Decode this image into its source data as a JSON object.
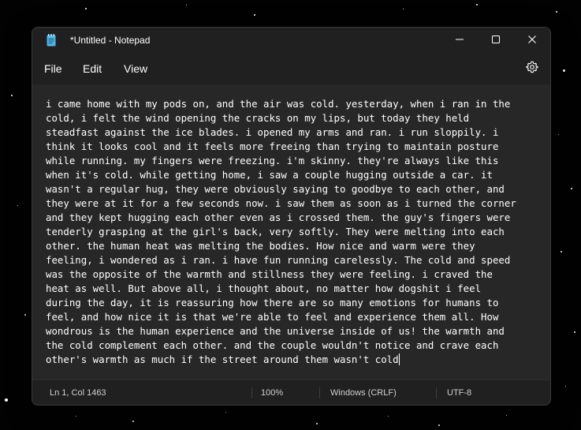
{
  "window": {
    "title": "*Untitled - Notepad",
    "app_icon": "notepad-icon"
  },
  "title_buttons": {
    "minimize_icon": "minimize-icon",
    "maximize_icon": "maximize-icon",
    "close_icon": "close-icon"
  },
  "menubar": {
    "items": [
      {
        "label": "File"
      },
      {
        "label": "Edit"
      },
      {
        "label": "View"
      }
    ],
    "settings_icon": "gear-icon"
  },
  "editor": {
    "lines": [
      "i came home with my pods on, and the air was cold. yesterday, when i ran in the",
      "cold, i felt the wind opening the cracks on my lips, but today they held",
      "steadfast against the ice blades. i opened my arms and ran. i run sloppily. i",
      "think it looks cool and it feels more freeing than trying to maintain posture",
      "while running. my fingers were freezing. i'm skinny. they're always like this",
      "when it's cold. while getting home, i saw a couple hugging outside a car. it",
      "wasn't a regular hug, they were obviously saying to goodbye to each other, and",
      "they were at it for a few seconds now. i saw them as soon as i turned the corner",
      "and they kept hugging each other even as i crossed them. the guy's fingers were",
      "tenderly grasping at the girl's back, very softly. They were melting into each",
      "other. the human heat was melting the bodies. How nice and warm were they",
      "feeling, i wondered as i ran. i have fun running carelessly. The cold and speed",
      "was the opposite of the warmth and stillness they were feeling. i craved the",
      "heat as well. But above all, i thought about, no matter how dogshit i feel",
      "during the day, it is reassuring how there are so many emotions for humans to",
      "feel, and how nice it is that we're able to feel and experience them all. How",
      "wondrous is the human experience and the universe inside of us! the warmth and",
      "the cold complement each other. and the couple wouldn't notice and crave each",
      "other's warmth as much if the street around them wasn't cold"
    ]
  },
  "statusbar": {
    "position": "Ln 1, Col 1463",
    "zoom": "100%",
    "line_ending": "Windows (CRLF)",
    "encoding": "UTF-8"
  },
  "colors": {
    "window_bg": "#202020",
    "editor_bg": "#272727",
    "text": "#ffffff",
    "icon_accent": "#4fb6e8"
  }
}
